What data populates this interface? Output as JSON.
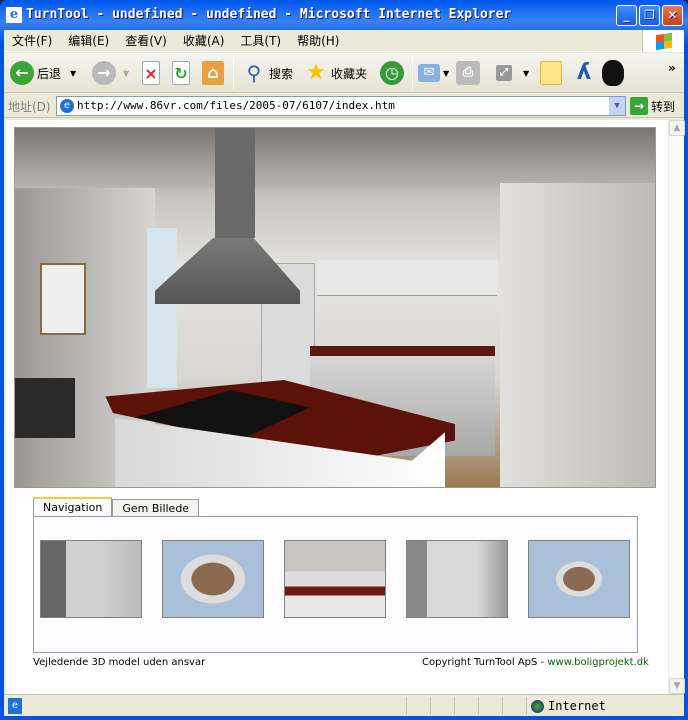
{
  "window": {
    "title": "TurnTool - undefined - undefined - Microsoft Internet Explorer"
  },
  "menu": [
    "文件(F)",
    "编辑(E)",
    "查看(V)",
    "收藏(A)",
    "工具(T)",
    "帮助(H)"
  ],
  "toolbar": {
    "back": "后退",
    "search": "搜索",
    "favorites": "收藏夹",
    "more": "»"
  },
  "address": {
    "label": "地址(D)",
    "url": "http://www.86vr.com/files/2005-07/6107/index.htm",
    "go": "转到"
  },
  "page": {
    "tabs": [
      "Navigation",
      "Gem Billede"
    ],
    "disclaimer": "Vejledende 3D model uden ansvar",
    "copyright": "Copyright TurnTool ApS - ",
    "link": "www.boligprojekt.dk"
  },
  "status": {
    "zone": "Internet"
  }
}
